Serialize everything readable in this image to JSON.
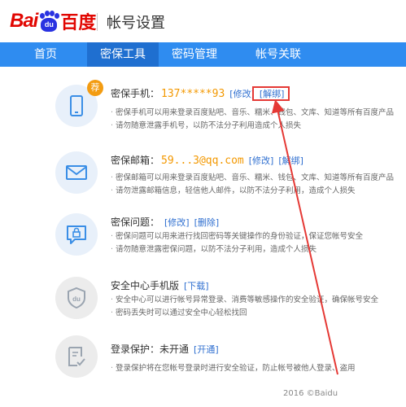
{
  "header": {
    "logo_text_1": "Bai",
    "logo_paw_text": "du",
    "logo_text_2": "百度",
    "title": "帐号设置"
  },
  "nav": {
    "items": [
      {
        "label": "首页"
      },
      {
        "label": "密保工具"
      },
      {
        "label": "密码管理"
      },
      {
        "label": "帐号关联"
      }
    ],
    "active_index": 1
  },
  "phone": {
    "badge": "荐",
    "label": "密保手机：",
    "value": "137*****93",
    "edit": "[修改]",
    "unbind": "[解绑]",
    "desc1": "密保手机可以用来登录百度贴吧、音乐、糯米、钱包、文库、知道等所有百度产品",
    "desc2": "请勿随意泄露手机号，以防不法分子利用造成个人损失"
  },
  "email": {
    "label": "密保邮箱：",
    "value": "59...3@qq.com",
    "edit": "[修改]",
    "unbind": "[解绑]",
    "desc1": "密保邮箱可以用来登录百度贴吧、音乐、糯米、钱包、文库、知道等所有百度产品",
    "desc2": "请勿泄露邮箱信息，轻信他人邮件，以防不法分子利用，造成个人损失"
  },
  "question": {
    "label": "密保问题：",
    "edit": "[修改]",
    "delete": "[删除]",
    "desc1": "密保问题可以用来进行找回密码等关键操作的身份验证，保证您帐号安全",
    "desc2": "请勿随意泄露密保问题，以防不法分子利用，造成个人损失"
  },
  "mobile_app": {
    "label": "安全中心手机版",
    "download": "[下载]",
    "desc1": "安全中心可以进行帐号异常登录、消费等敏感操作的安全验证，确保帐号安全",
    "desc2": "密码丢失时可以通过安全中心轻松找回"
  },
  "login_protect": {
    "label": "登录保护：",
    "status": "未开通",
    "enable": "[开通]",
    "desc1": "登录保护将在您帐号登录时进行安全验证，防止帐号被他人登录、盗用"
  },
  "footer": {
    "copyright": "2016 ©Baidu"
  },
  "colors": {
    "brand_red": "#e10601",
    "brand_blue": "#2932e1",
    "nav_bg": "#2f8cf0",
    "nav_active": "#1f6fd0",
    "value_orange": "#f39800",
    "link_blue": "#2f6fd0",
    "highlight_red": "#e53935"
  }
}
